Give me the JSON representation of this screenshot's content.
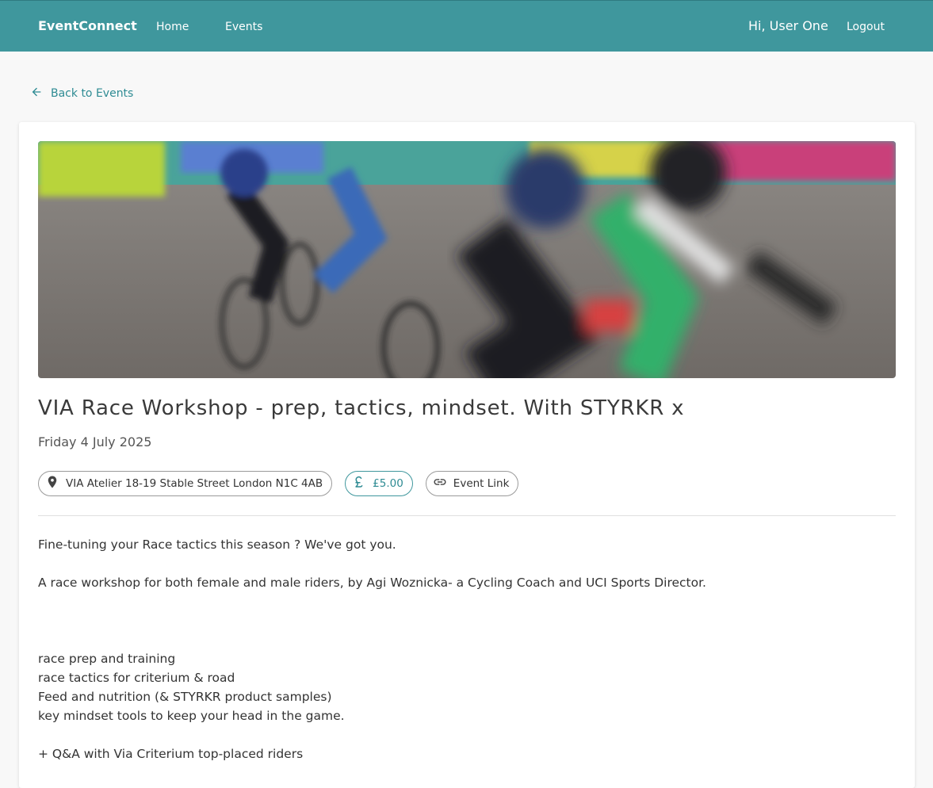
{
  "navbar": {
    "brand": "EventConnect",
    "links": [
      "Home",
      "Events"
    ],
    "greeting": "Hi, User One",
    "logout": "Logout"
  },
  "back_link": {
    "label": "Back to Events",
    "icon": "arrow-left-icon"
  },
  "event": {
    "title": "VIA Race Workshop - prep, tactics, mindset. With STYRKR x",
    "date": "Friday 4 July 2025",
    "location": "VIA Atelier 18-19 Stable Street London N1C 4AB",
    "price": "£5.00",
    "link_label": "Event Link",
    "description": [
      "Fine-tuning your Race tactics this season ? We've got you.",
      "A race workshop for both female and male riders, by Agi Woznicka- a Cycling Coach and UCI Sports Director.",
      "race prep and training",
      "race tactics for criterium & road",
      "Feed and nutrition (& STYRKR product samples)",
      "key mindset tools to keep your head in the game.",
      "+ Q&A with Via Criterium top-placed riders"
    ]
  },
  "colors": {
    "primary": "#3f979d",
    "link": "#2e8b93",
    "background": "#f8f8f8"
  }
}
